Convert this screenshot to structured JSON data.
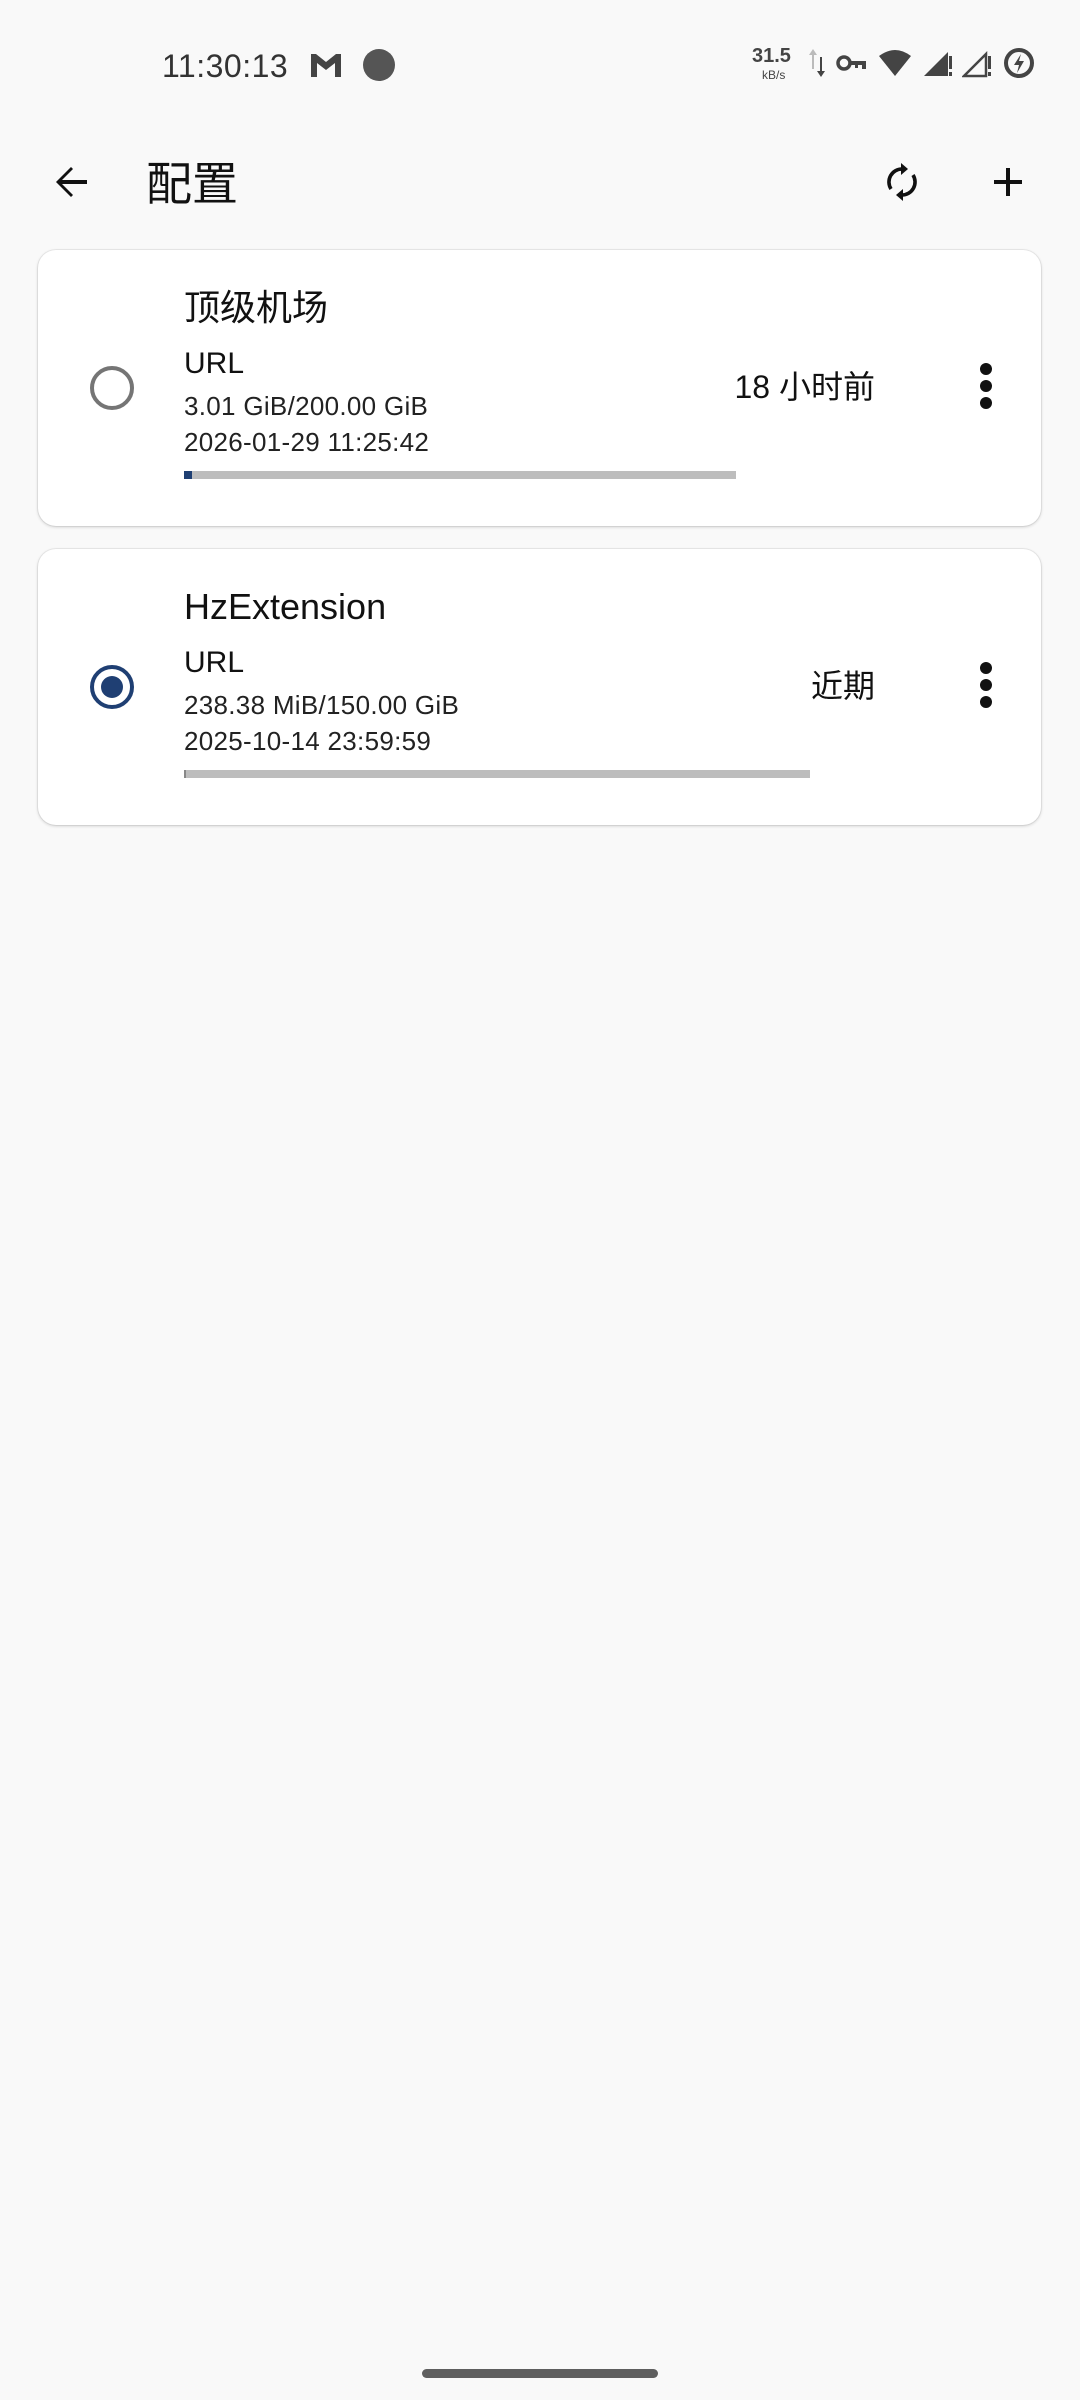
{
  "status_bar": {
    "time": "11:30:13",
    "net_speed_value": "31.5",
    "net_speed_unit": "kB/s",
    "icons": [
      "gmail-icon",
      "record-dot-icon",
      "data-arrows-icon",
      "vpn-key-icon",
      "wifi-icon",
      "signal-icon",
      "signal-no-data-icon",
      "battery-saver-icon"
    ]
  },
  "app_bar": {
    "title": "配置",
    "icons": [
      "back-arrow-icon",
      "refresh-icon",
      "add-icon"
    ]
  },
  "profiles": [
    {
      "name": "顶级机场",
      "type": "URL",
      "usage": "3.01 GiB/200.00 GiB",
      "expire": "2026-01-29 11:25:42",
      "updated": "18 小时前",
      "selected": false,
      "usage_fraction": 0.015
    },
    {
      "name": "HzExtension",
      "type": "URL",
      "usage": "238.38 MiB/150.00 GiB",
      "expire": "2025-10-14 23:59:59",
      "updated": "近期",
      "selected": true,
      "usage_fraction": 0.0016
    }
  ],
  "colors": {
    "accent": "#1f3f73",
    "progress_track": "#bdbdbd",
    "background": "#f9f9f9",
    "card": "#ffffff"
  }
}
